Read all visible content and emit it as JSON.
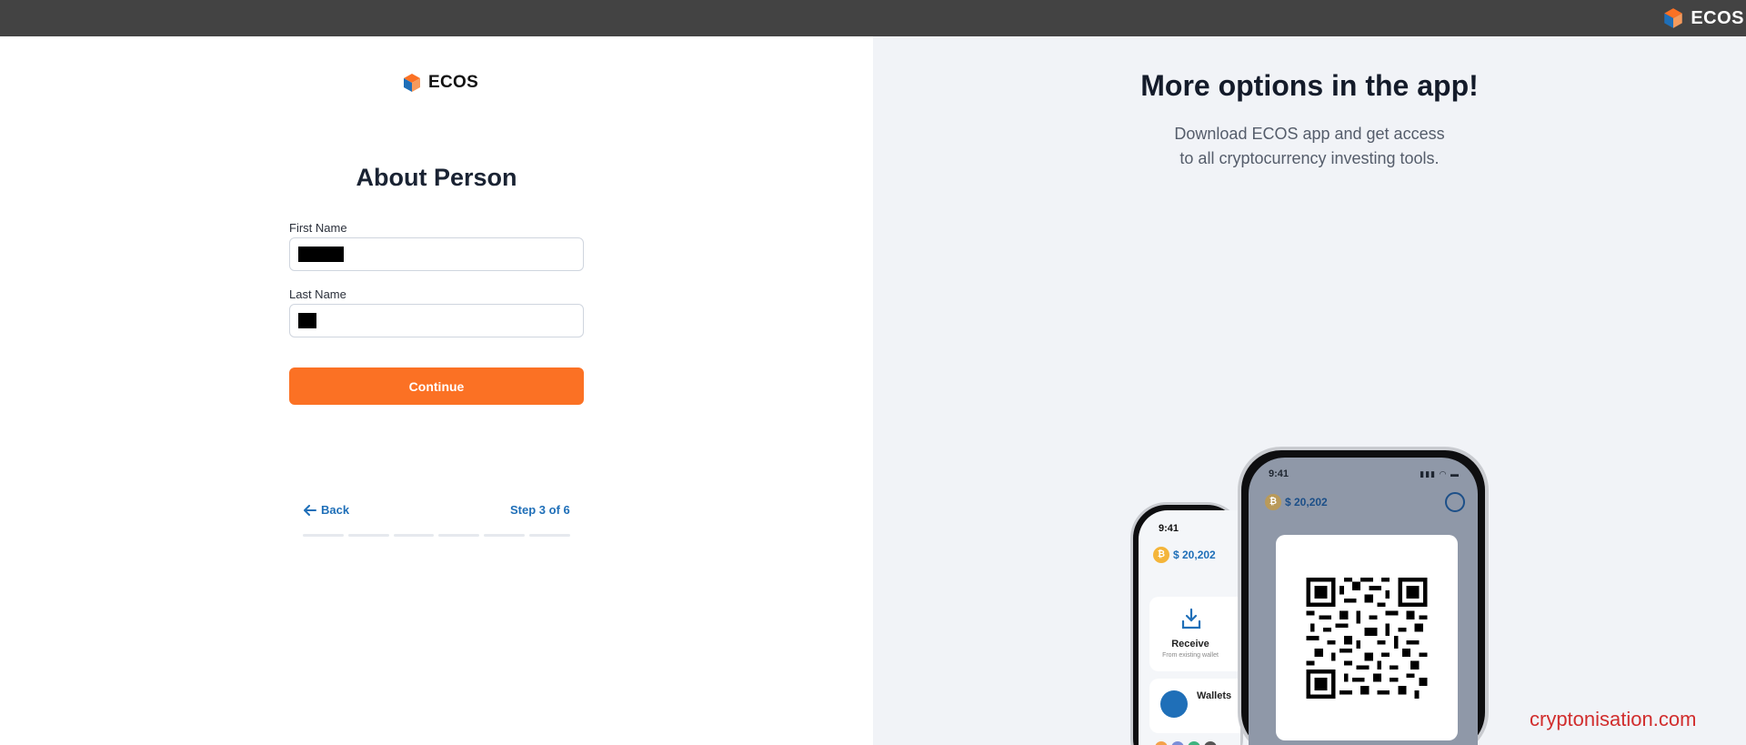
{
  "topbar": {
    "brand": "ECOS"
  },
  "form": {
    "brand": "ECOS",
    "title": "About Person",
    "first_name_label": "First Name",
    "last_name_label": "Last Name",
    "continue_label": "Continue",
    "back_label": "Back",
    "step_text": "Step 3 of 6",
    "current_step": 3,
    "total_steps": 6
  },
  "promo": {
    "title": "More options in the app!",
    "description": "Download ECOS app and get access to all cryptocurrency investing tools.",
    "phone_back": {
      "time": "9:41",
      "balance": "$ 20,202",
      "receive_label": "Receive",
      "receive_sub": "From existing wallet",
      "wallets_label": "Wallets"
    },
    "phone_front": {
      "time": "9:41",
      "balance": "$ 20,202"
    }
  },
  "watermark": "cryptonisation.com",
  "colors": {
    "accent": "#fb7124",
    "link": "#1f6fb8",
    "topbar": "#434343"
  }
}
